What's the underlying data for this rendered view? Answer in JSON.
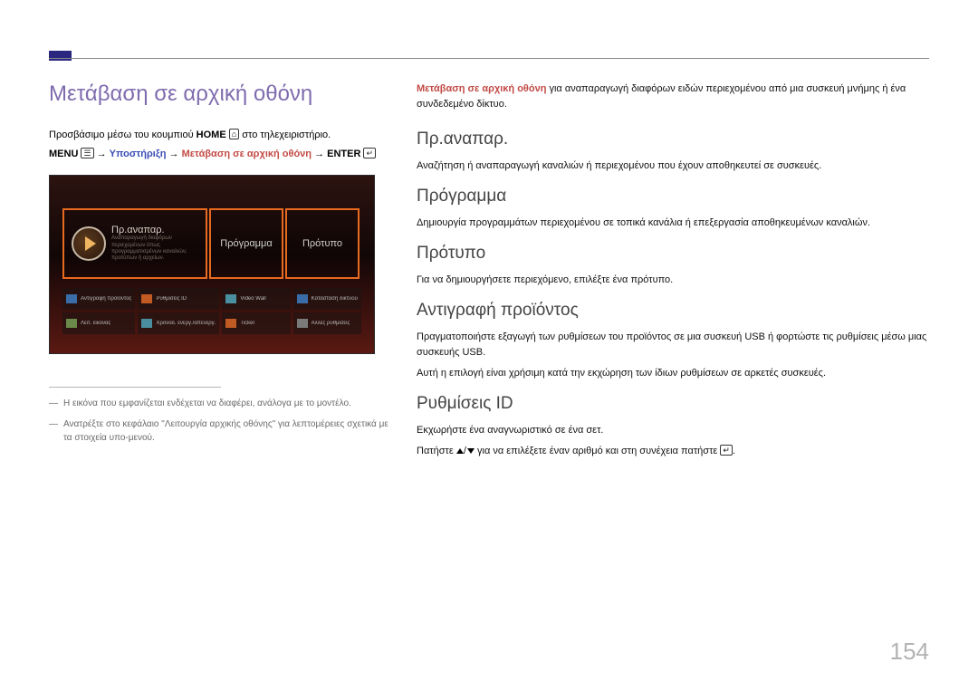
{
  "page_number": "154",
  "left": {
    "title": "Μετάβαση σε αρχική οθόνη",
    "access_line_a": "Προσβάσιμο μέσω του κουμπιού ",
    "access_line_b": " στο τηλεχειριστήριο.",
    "home_label": "HOME",
    "home_icon": "⌂",
    "path": {
      "menu": "MENU",
      "menu_icon": "☰",
      "arrow": "→",
      "support": "Υποστήριξη",
      "goto": "Μετάβαση σε αρχική οθόνη",
      "enter": "ENTER",
      "enter_icon": "↵"
    },
    "screenshot": {
      "card1_title": "Πρ.αναπαρ.",
      "card1_sub1": "Αναπαραγωγή διαφόρων",
      "card1_sub2": "περιεχομένων όπως",
      "card1_sub3": "προγραμματισμένων καναλιών,",
      "card1_sub4": "προτύπων ή αρχείων.",
      "card2": "Πρόγραμμα",
      "card3": "Πρότυπο",
      "chips": [
        "Αντιγραφή προϊόντος",
        "Ρυθμίσεις ID",
        "Video Wall",
        "Κατάσταση δικτύου",
        "Λειτ. εικόνας",
        "Χρονοδ. ενεργ./απενεργ.",
        "Ticker",
        "Άλλες ρυθμίσεις"
      ]
    },
    "notes": [
      "Η εικόνα που εμφανίζεται ενδέχεται να διαφέρει, ανάλογα με το μοντέλο.",
      "Ανατρέξτε στο κεφάλαιο \"Λειτουργία αρχικής οθόνης\" για λεπτομέρειες σχετικά με τα στοιχεία υπο-μενού."
    ]
  },
  "right": {
    "intro_red": "Μετάβαση σε αρχική οθόνη",
    "intro_rest": " για αναπαραγωγή διαφόρων ειδών περιεχομένου από μια συσκευή μνήμης ή ένα συνδεδεμένο δίκτυο.",
    "sections": [
      {
        "heading": "Πρ.αναπαρ.",
        "paras": [
          "Αναζήτηση ή αναπαραγωγή καναλιών ή περιεχομένου που έχουν αποθηκευτεί σε συσκευές."
        ]
      },
      {
        "heading": "Πρόγραμμα",
        "paras": [
          "Δημιουργία προγραμμάτων περιεχομένου σε τοπικά κανάλια ή επεξεργασία αποθηκευμένων καναλιών."
        ]
      },
      {
        "heading": "Πρότυπο",
        "paras": [
          "Για να δημιουργήσετε περιεχόμενο, επιλέξτε ένα πρότυπο."
        ]
      },
      {
        "heading": "Αντιγραφή προϊόντος",
        "paras": [
          "Πραγματοποιήστε εξαγωγή των ρυθμίσεων του προϊόντος σε μια συσκευή USB ή φορτώστε τις ρυθμίσεις μέσω μιας συσκευής USB.",
          "Αυτή η επιλογή είναι χρήσιμη κατά την εκχώρηση των ίδιων ρυθμίσεων σε αρκετές συσκευές."
        ]
      },
      {
        "heading": "Ρυθμίσεις ID",
        "paras": [
          "Εκχωρήστε ένα αναγνωριστικό σε ένα σετ."
        ],
        "press_a": "Πατήστε ",
        "press_b": " για να επιλέξετε έναν αριθμό και στη συνέχεια πατήστε ",
        "press_c": "."
      }
    ]
  }
}
